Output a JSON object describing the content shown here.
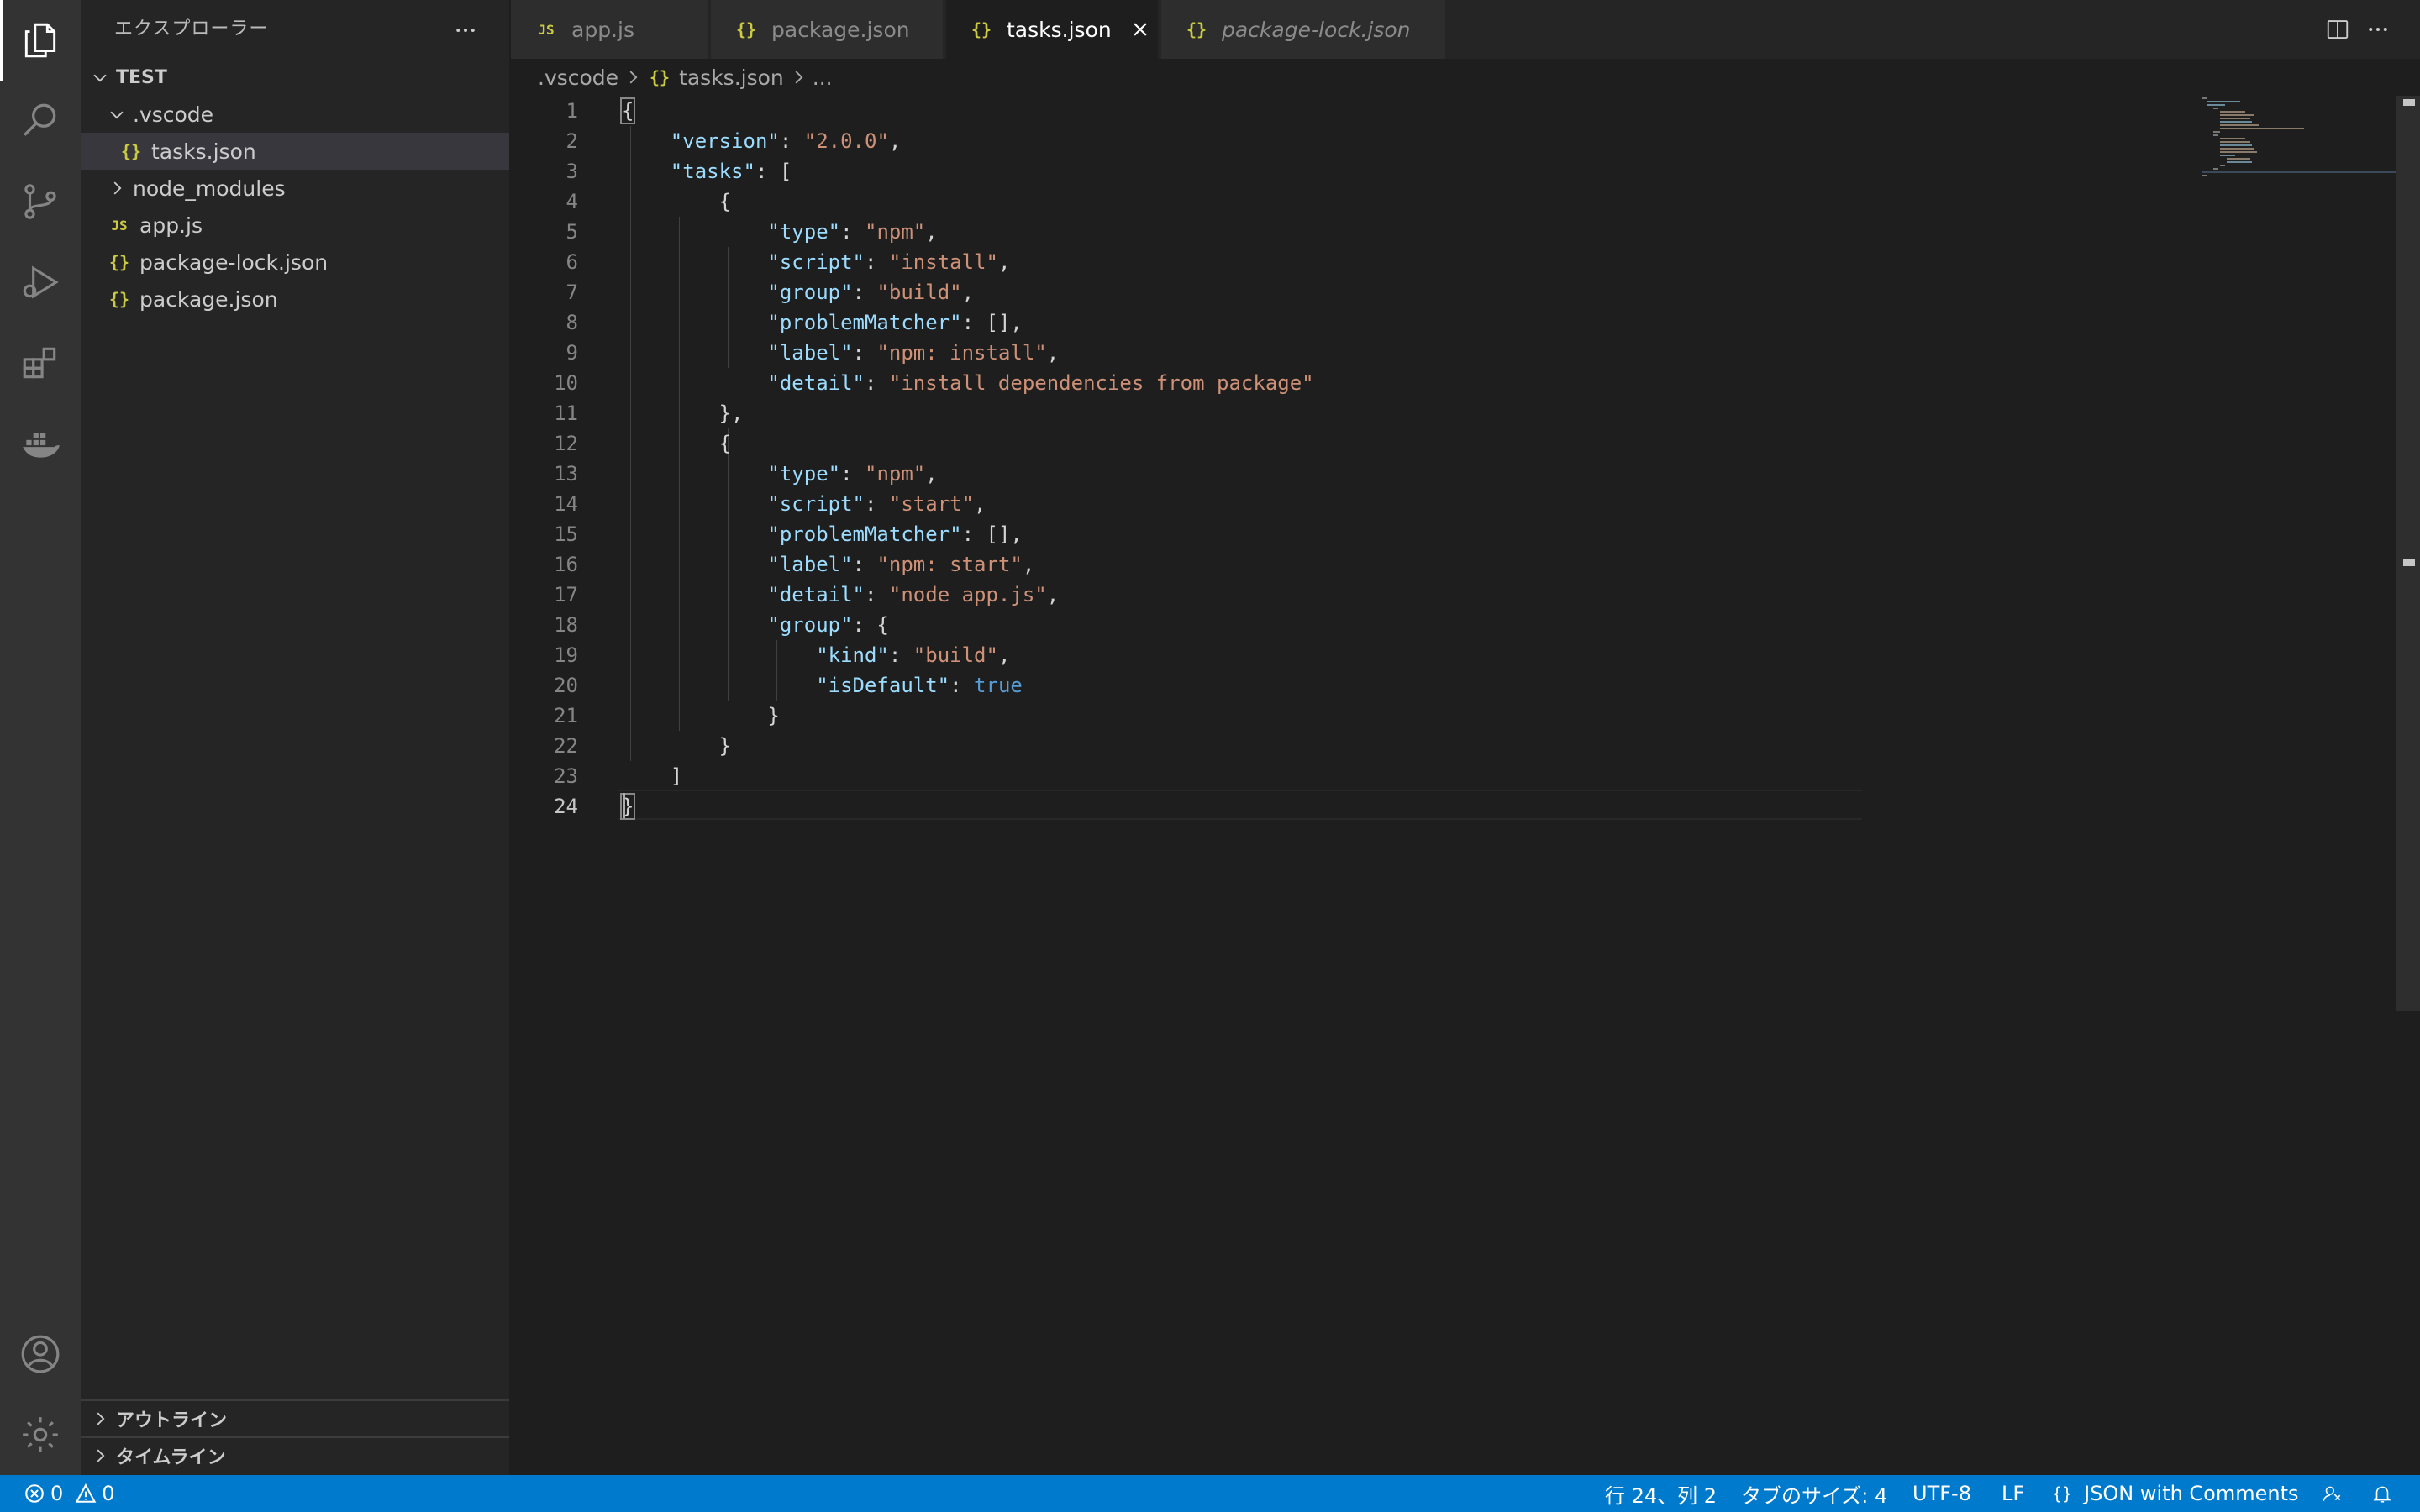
{
  "activity_bar": {
    "items": [
      "files-icon",
      "search-icon",
      "source-control-icon",
      "run-debug-icon",
      "extensions-icon",
      "docker-icon"
    ],
    "bottom": [
      "account-icon",
      "settings-gear-icon"
    ]
  },
  "sidebar": {
    "title": "エクスプローラー",
    "root": "TEST",
    "tree": [
      {
        "label": ".vscode",
        "type": "folder",
        "expanded": true
      },
      {
        "label": "tasks.json",
        "type": "json",
        "selected": true
      },
      {
        "label": "node_modules",
        "type": "folder",
        "expanded": false
      },
      {
        "label": "app.js",
        "type": "js"
      },
      {
        "label": "package-lock.json",
        "type": "json"
      },
      {
        "label": "package.json",
        "type": "json"
      }
    ],
    "outline": "アウトライン",
    "timeline": "タイムライン"
  },
  "tabs": [
    {
      "label": "app.js",
      "icon": "JS",
      "active": false,
      "italic": false
    },
    {
      "label": "package.json",
      "icon": "{}",
      "active": false,
      "italic": false
    },
    {
      "label": "tasks.json",
      "icon": "{}",
      "active": true,
      "italic": false
    },
    {
      "label": "package-lock.json",
      "icon": "{}",
      "active": false,
      "italic": true
    }
  ],
  "breadcrumb": {
    "folder": ".vscode",
    "file": "tasks.json",
    "more": "..."
  },
  "editor": {
    "lines": [
      "1",
      "2",
      "3",
      "4",
      "5",
      "6",
      "7",
      "8",
      "9",
      "10",
      "11",
      "12",
      "13",
      "14",
      "15",
      "16",
      "17",
      "18",
      "19",
      "20",
      "21",
      "22",
      "23",
      "24"
    ],
    "code": {
      "version_key": "\"version\"",
      "version_val": "\"2.0.0\"",
      "tasks_key": "\"tasks\"",
      "t1_type": "\"npm\"",
      "t1_script": "\"install\"",
      "t1_group": "\"build\"",
      "t1_label": "\"npm: install\"",
      "t1_detail": "\"install dependencies from package\"",
      "t2_type": "\"npm\"",
      "t2_script": "\"start\"",
      "t2_label": "\"npm: start\"",
      "t2_detail": "\"node app.js\"",
      "kind_val": "\"build\"",
      "isdefault_val": "true",
      "k_type": "\"type\"",
      "k_script": "\"script\"",
      "k_group": "\"group\"",
      "k_problem": "\"problemMatcher\"",
      "k_label": "\"label\"",
      "k_detail": "\"detail\"",
      "k_kind": "\"kind\"",
      "k_isdefault": "\"isDefault\""
    }
  },
  "statusbar": {
    "errors": "0",
    "warnings": "0",
    "position": "行 24、列 2",
    "tab_size": "タブのサイズ: 4",
    "encoding": "UTF-8",
    "eol": "LF",
    "language_icon": "{}",
    "language": "JSON with Comments"
  },
  "colors": {
    "statusbar": "#007acc",
    "key": "#9cdcfe",
    "string": "#ce9178",
    "boolean": "#569cd6",
    "json_icon": "#cbcb41"
  }
}
